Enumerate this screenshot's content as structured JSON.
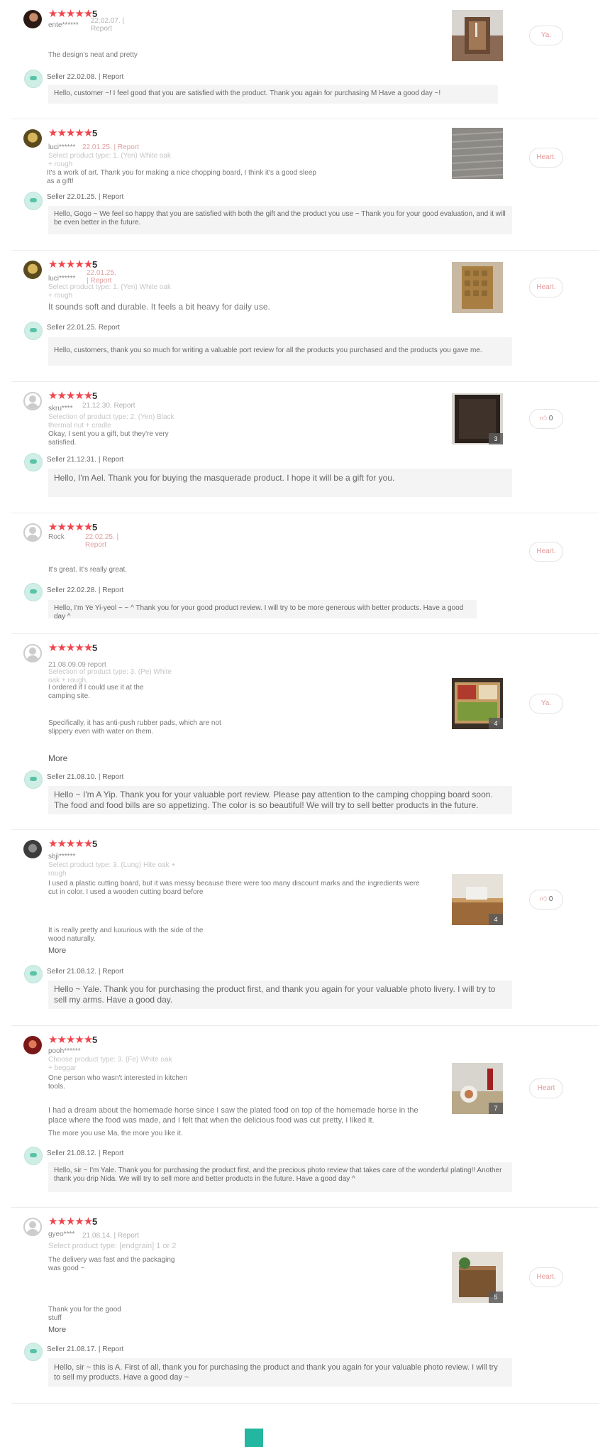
{
  "reviews": [
    {
      "stars": "★★★★★",
      "score": "5",
      "user": "ente******",
      "meta": "22.02.07. | Report",
      "option": "",
      "text": "The design's neat and pretty",
      "more": "",
      "thumb_count": "",
      "side": "Ya.",
      "seller_head": "Seller 22.02.08. | Report",
      "reply": "Hello, customer ~! I feel good that you are satisfied with the product. Thank you again for purchasing M Have a good day ~!"
    },
    {
      "stars": "★★★★★",
      "score": "5",
      "user": "luci******",
      "meta": "22.01.25. | Report",
      "option": "Select product type: 1. (Yen) White oak + rough",
      "text": "It's a work of art. Thank you for making a nice chopping board, I think it's a good sleep as a gift!",
      "more": "",
      "thumb_count": "",
      "side": "Heart.",
      "seller_head": "Seller 22.01.25. | Report",
      "reply": "Hello, Gogo ~ We feel so happy that you are satisfied with both the gift and the product you use ~ Thank you for your good evaluation, and it will be even better in the future."
    },
    {
      "stars": "★★★★★",
      "score": "5",
      "user": "luci******",
      "meta": "22.01.25. | Report",
      "option": "Select product type: 1. (Yen) White oak + rough",
      "text": "It sounds soft and durable. It feels a bit heavy for daily use.",
      "more": "",
      "thumb_count": "",
      "side": "Heart.",
      "seller_head": "Seller 22.01.25. Report",
      "reply": "Hello, customers, thank you so much for writing a valuable port review for all the products you purchased and the products you gave me."
    },
    {
      "stars": "★★★★★",
      "score": "5",
      "user": "skru****",
      "meta": "21.12.30. Report",
      "option": "Selection of product type: 2. (Yen) Black thermal nut + cradle",
      "text": "Okay, I sent you a gift, but they're very satisfied.",
      "more": "",
      "thumb_count": "3",
      "side": "0",
      "seller_head": "Seller 21.12.31. | Report",
      "reply": "Hello, I'm Ael. Thank you for buying the masquerade product. I hope it will be a gift for you."
    },
    {
      "stars": "★★★★★",
      "score": "5",
      "user": "Rock",
      "meta": "22.02.25. | Report",
      "option": "",
      "text": "It's great. It's really great.",
      "more": "",
      "thumb_count": "",
      "side": "Heart.",
      "seller_head": "Seller 22.02.28. | Report",
      "reply": "Hello, I'm Ye Yi-yeol ~ ~ ^ Thank you for your good product review. I will try to be more generous with better products. Have a good day ^"
    },
    {
      "stars": "★★★★★",
      "score": "5",
      "user": "",
      "meta": "21.08.09.09 report",
      "option": "Selection of product type: 3. (Pe) White oak + rough.",
      "text": "I ordered if I could use it at the camping site.",
      "text2": "Specifically, it has anti-push rubber pads, which are not slippery even with water on them.",
      "more": "More",
      "thumb_count": "4",
      "side": "Ya.",
      "seller_head": "Seller 21.08.10. | Report",
      "reply": "Hello ~ I'm A Yip. Thank you for your valuable port review. Please pay attention to the camping chopping board soon. The food and food bills are so appetizing. The color is so beautiful! We will try to sell better products in the future."
    },
    {
      "stars": "★★★★★",
      "score": "5",
      "user": "sbji******",
      "meta": "",
      "option": "Select product type: 3. (Lung) Hite oak + rough",
      "text": "I used a plastic cutting board, but it was messy because there were too many discount marks and the ingredients were cut in color. I used a wooden cutting board before",
      "text2": "It is really pretty and luxurious with the side of the wood naturally.",
      "more": "More",
      "thumb_count": "4",
      "side": "0",
      "seller_head": "Seller 21.08.12. | Report",
      "reply": "Hello ~ Yale. Thank you for purchasing the product first, and thank you again for your valuable photo livery. I will try to sell my arms. Have a good day."
    },
    {
      "stars": "★★★★★",
      "score": "5",
      "user": "pooh******",
      "meta": "",
      "option": "Choose product type: 3. (Fe) White oak + beggar",
      "text": "One person who wasn't interested in kitchen tools.",
      "text2": "I had a dream about the homemade horse since I saw the plated food on top of the homemade horse in the place where the food was made, and I felt that when the delicious food was cut pretty, I liked it.",
      "text3": "The more you use Ma, the more you like it.",
      "more": "",
      "thumb_count": "7",
      "side": "Heart",
      "seller_head": "Seller 21.08.12. | Report",
      "reply": "Hello, sir ~ I'm Yale. Thank you for purchasing the product first, and the precious photo review that takes care of the wonderful plating!! Another thank you drip Nida. We will try to sell more and better products in the future. Have a good day ^"
    },
    {
      "stars": "★★★★★",
      "score": "5",
      "user": "gyeo****",
      "meta": "21.08.14. | Report",
      "option": "Select product type: [endgrain] 1 or 2",
      "text": "The delivery was fast and the packaging was good ~",
      "text2": "Thank you for the good stuff",
      "more": "More",
      "thumb_count": "5",
      "side": "Heart.",
      "seller_head": "Seller 21.08.17. | Report",
      "reply": "Hello, sir ~ this is A. First of all, thank you for purchasing the product and thank you again for your valuable photo review. I will try to sell my products. Have a good day ~"
    }
  ],
  "icons": {
    "star": "star-icon",
    "thumb": "thumbs-up-icon",
    "seller": "seller-logo-icon"
  },
  "colors": {
    "star": "#f0454d",
    "accent": "#23b6a0"
  }
}
